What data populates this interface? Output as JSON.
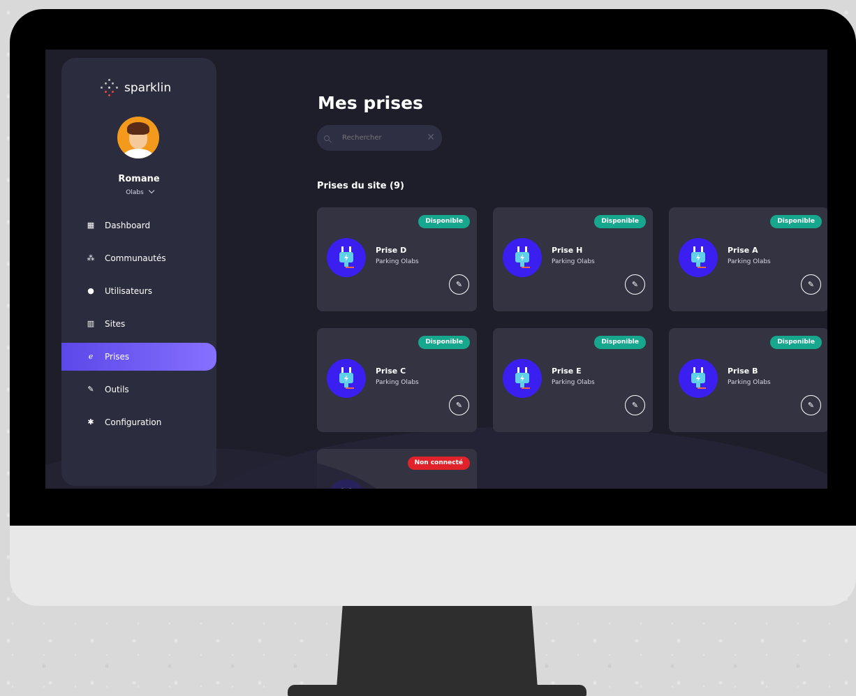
{
  "app": {
    "logo_text": "sparklin"
  },
  "user": {
    "name": "Romane",
    "org": "Olabs"
  },
  "nav": [
    {
      "label": "Dashboard",
      "icon": "grid-icon",
      "glyph": "▦",
      "active": false
    },
    {
      "label": "Communautés",
      "icon": "community-icon",
      "glyph": "⁂",
      "active": false
    },
    {
      "label": "Utilisateurs",
      "icon": "user-icon",
      "glyph": "●",
      "active": false
    },
    {
      "label": "Sites",
      "icon": "building-icon",
      "glyph": "▥",
      "active": false
    },
    {
      "label": "Prises",
      "icon": "plug-icon",
      "glyph": "ℯ",
      "active": true
    },
    {
      "label": "Outils",
      "icon": "wrench-icon",
      "glyph": "✎",
      "active": false
    },
    {
      "label": "Configuration",
      "icon": "gear-icon",
      "glyph": "✱",
      "active": false
    }
  ],
  "main": {
    "title": "Mes prises",
    "search_placeholder": "Rechercher",
    "section_title": "Prises du site (9)"
  },
  "cards": [
    {
      "name": "Prise D",
      "location": "Parking Olabs",
      "status": "Disponible",
      "status_type": "ok"
    },
    {
      "name": "Prise H",
      "location": "Parking Olabs",
      "status": "Disponible",
      "status_type": "ok"
    },
    {
      "name": "Prise A",
      "location": "Parking Olabs",
      "status": "Disponible",
      "status_type": "ok"
    },
    {
      "name": "Prise C",
      "location": "Parking Olabs",
      "status": "Disponible",
      "status_type": "ok"
    },
    {
      "name": "Prise E",
      "location": "Parking Olabs",
      "status": "Disponible",
      "status_type": "ok"
    },
    {
      "name": "Prise B",
      "location": "Parking Olabs",
      "status": "Disponible",
      "status_type": "ok"
    },
    {
      "name": "",
      "location": "",
      "status": "Non connecté",
      "status_type": "bad"
    }
  ],
  "colors": {
    "accent": "#6c58f2",
    "ok": "#17a78e",
    "bad": "#e0232b",
    "plug_bg": "#3b1ff0"
  }
}
